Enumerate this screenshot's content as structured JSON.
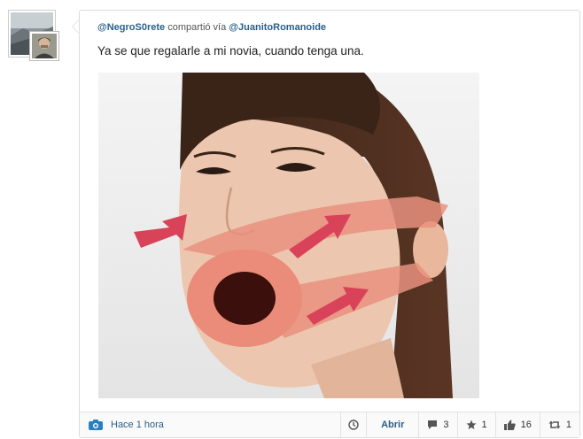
{
  "post": {
    "author": "@NegroS0rete",
    "shared_via": "compartió vía",
    "original_author": "@JuanitoRomanoide",
    "text": "Ya se que regalarle a mi novia, cuando tenga una."
  },
  "footer": {
    "time": "Hace 1 hora",
    "open_label": "Abrir",
    "comments": "3",
    "favorites": "1",
    "likes": "16",
    "retweets": "1"
  },
  "colors": {
    "link": "#2a5f8a",
    "border": "#dcdcdc",
    "arrows": "#d9435a",
    "icon_gray": "#555555"
  },
  "icons": [
    "camera-icon",
    "clock-icon",
    "comment-icon",
    "star-icon",
    "thumbs-up-icon",
    "retweet-icon"
  ]
}
